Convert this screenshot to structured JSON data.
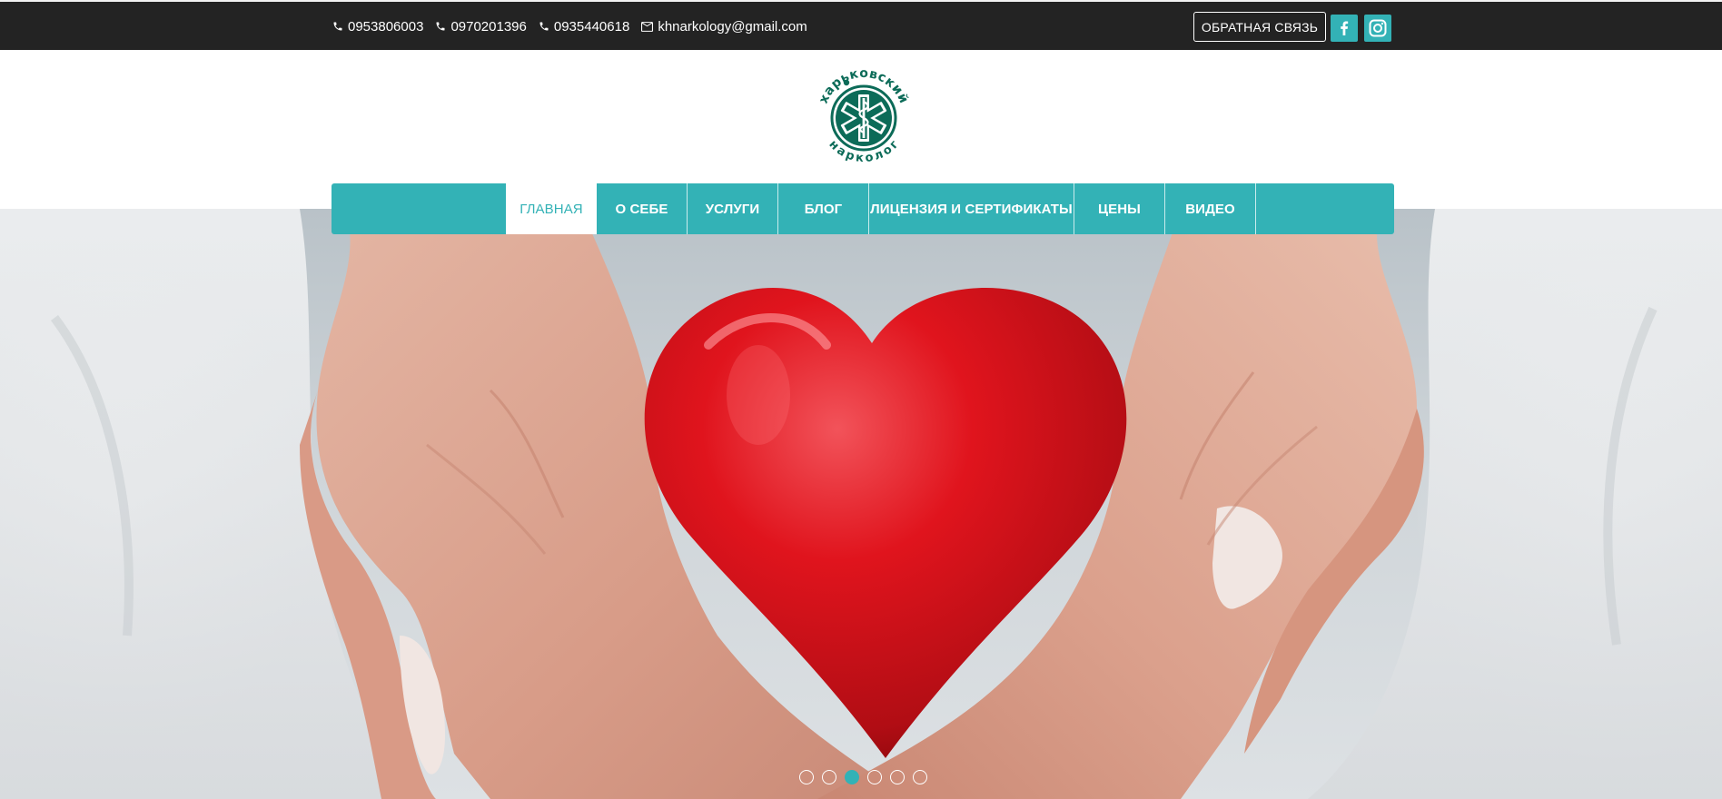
{
  "topbar": {
    "contacts": [
      {
        "icon": "phone-icon",
        "text": "0953806003"
      },
      {
        "icon": "phone-icon",
        "text": "0970201396"
      },
      {
        "icon": "phone-icon",
        "text": "0935440618"
      },
      {
        "icon": "mail-icon",
        "text": "khnarkology@gmail.com"
      }
    ],
    "feedback_label": "ОБРАТНАЯ СВЯЗЬ",
    "social": [
      {
        "name": "facebook-icon"
      },
      {
        "name": "instagram-icon"
      }
    ]
  },
  "logo": {
    "top_text": "харьковский",
    "bottom_text": "нарколог"
  },
  "nav": {
    "items": [
      {
        "label": "ГЛАВНАЯ",
        "active": true
      },
      {
        "label": "О СЕБЕ"
      },
      {
        "label": "УСЛУГИ"
      },
      {
        "label": "БЛОГ"
      },
      {
        "label": "ЛИЦЕНЗИЯ И СЕРТИФИКАТЫ"
      },
      {
        "label": "ЦЕНЫ"
      },
      {
        "label": "ВИДЕО"
      }
    ]
  },
  "slider": {
    "slide_count": 6,
    "active_index": 2
  },
  "colors": {
    "accent": "#33b2b6",
    "topbar": "#232323",
    "logo_green": "#0c6b58",
    "heart_red": "#d4141c"
  }
}
